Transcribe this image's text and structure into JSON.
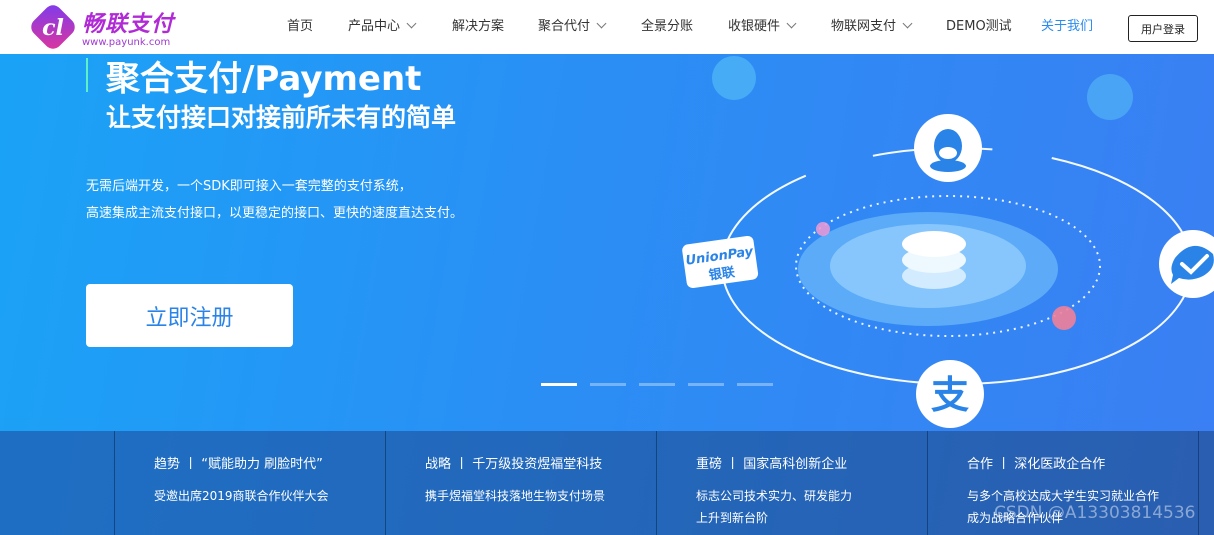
{
  "brand": {
    "logo_letter": "cl",
    "name": "畅联支付",
    "url": "www.payunk.com"
  },
  "nav": {
    "items": [
      {
        "label": "首页",
        "dropdown": false,
        "active": false
      },
      {
        "label": "产品中心",
        "dropdown": true,
        "active": false
      },
      {
        "label": "解决方案",
        "dropdown": false,
        "active": false
      },
      {
        "label": "聚合代付",
        "dropdown": true,
        "active": false
      },
      {
        "label": "全景分账",
        "dropdown": false,
        "active": false
      },
      {
        "label": "收银硬件",
        "dropdown": true,
        "active": false
      },
      {
        "label": "物联网支付",
        "dropdown": true,
        "active": false
      },
      {
        "label": "DEMO测试",
        "dropdown": false,
        "active": false
      },
      {
        "label": "关于我们",
        "dropdown": false,
        "active": true
      }
    ],
    "login_label": "用户登录",
    "accent_color": "#2a8cf0"
  },
  "hero": {
    "title": "聚合支付/Payment",
    "subtitle": "让支付接口对接前所未有的简单",
    "desc_line1": "无需后端开发，一个SDK即可接入一套完整的支付系统，",
    "desc_line2": "高速集成主流支付接口，以更稳定的接口、更快的速度直达支付。",
    "register_label": "立即注册",
    "unionpay_text": "UnionPay",
    "unionpay_cn": "银联",
    "alipay_glyph": "支",
    "slides_total": 5,
    "slide_active": 1,
    "bg_color": "#1e96f5"
  },
  "news": [
    {
      "title": "趋势 丨 “赋能助力 刷脸时代”",
      "lines": [
        "受邀出席2019商联合作伙伴大会"
      ]
    },
    {
      "title": "战略 丨 千万级投资煜福堂科技",
      "lines": [
        "携手煜福堂科技落地生物支付场景"
      ]
    },
    {
      "title": "重磅 丨 国家高科创新企业",
      "lines": [
        "标志公司技术实力、研发能力",
        "上升到新台阶"
      ]
    },
    {
      "title": "合作 丨 深化医政企合作",
      "lines": [
        "与多个高校达成大学生实习就业合作",
        "成为战略合作伙伴"
      ]
    }
  ],
  "watermark": "CSDN @A13303814536"
}
